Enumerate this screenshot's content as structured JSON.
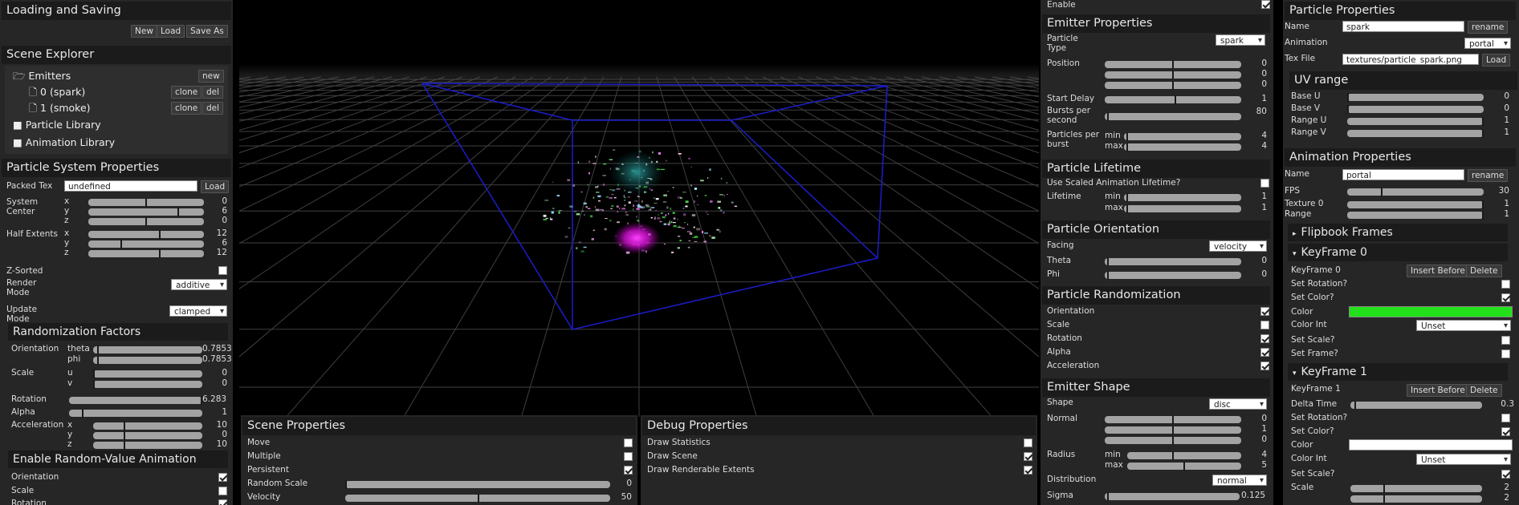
{
  "left": {
    "loading": {
      "title": "Loading and Saving",
      "new": "New",
      "load": "Load",
      "save_as": "Save As"
    },
    "scene_explorer": {
      "title": "Scene Explorer",
      "emitters": "Emitters",
      "new": "new",
      "items": [
        "0 (spark)",
        "1 (smoke)"
      ],
      "clone": "clone",
      "del": "del",
      "particle_library": "Particle Library",
      "animation_library": "Animation Library"
    },
    "psp": {
      "title": "Particle System Properties",
      "packed_tex_label": "Packed Tex",
      "packed_tex_value": "undefined",
      "load": "Load",
      "system_center": "System\nCenter",
      "half_extents": "Half Extents",
      "x": "x",
      "y": "y",
      "z": "z",
      "center_vals": [
        "0",
        "6",
        "0"
      ],
      "center_fill": [
        0.5,
        0.78,
        0.5
      ],
      "extent_vals": [
        "12",
        "6",
        "12"
      ],
      "extent_fill": [
        0.62,
        0.28,
        0.62
      ],
      "zsorted": "Z-Sorted",
      "render_mode": "Render\nMode",
      "render_mode_value": "additive",
      "update_mode": "Update\nMode",
      "update_mode_value": "clamped"
    },
    "rand": {
      "title": "Randomization Factors",
      "orientation": "Orientation",
      "theta": "theta",
      "phi": "phi",
      "theta_val": "0.7853",
      "phi_val": "0.7853",
      "scale": "Scale",
      "u": "u",
      "v": "v",
      "u_val": "0",
      "v_val": "0",
      "rotation": "Rotation",
      "rotation_val": "6.283",
      "alpha": "Alpha",
      "alpha_val": "1",
      "acceleration": "Acceleration",
      "acc_vals": [
        "10",
        "0",
        "10"
      ]
    },
    "anim": {
      "title": "Enable Random-Value Animation",
      "orientation": "Orientation",
      "scale": "Scale",
      "rotation": "Rotation"
    }
  },
  "bottom": {
    "scene": {
      "title": "Scene Properties",
      "move": "Move",
      "multiple": "Multiple",
      "persistent": "Persistent",
      "random_scale": "Random Scale",
      "random_scale_val": "0",
      "velocity": "Velocity",
      "velocity_val": "50"
    },
    "debug": {
      "title": "Debug Properties",
      "stats": "Draw Statistics",
      "scene": "Draw Scene",
      "extents": "Draw Renderable Extents"
    }
  },
  "mid": {
    "enable": "Enable",
    "emitter": {
      "title": "Emitter Properties",
      "particle_type": "Particle\nType",
      "particle_type_value": "spark",
      "position": "Position",
      "pos_vals": [
        "0",
        "0",
        "0"
      ],
      "start_delay": "Start Delay",
      "start_delay_val": "1",
      "bursts": "Bursts per\nsecond",
      "bursts_val": "80",
      "particles": "Particles per\nburst",
      "min": "min",
      "max": "max",
      "min_val": "4",
      "max_val": "4"
    },
    "lifetime": {
      "title": "Particle Lifetime",
      "use_scaled": "Use Scaled Animation Lifetime?",
      "lifetime": "Lifetime",
      "min": "min",
      "max": "max",
      "min_val": "1",
      "max_val": "1"
    },
    "orientation": {
      "title": "Particle Orientation",
      "facing": "Facing",
      "facing_value": "velocity",
      "theta": "Theta",
      "phi": "Phi",
      "theta_val": "0",
      "phi_val": "0"
    },
    "randomization": {
      "title": "Particle Randomization",
      "items": [
        "Orientation",
        "Scale",
        "Rotation",
        "Alpha",
        "Acceleration"
      ]
    },
    "shape": {
      "title": "Emitter Shape",
      "shape": "Shape",
      "shape_value": "disc",
      "normal": "Normal",
      "normal_vals": [
        "0",
        "1",
        "0"
      ],
      "radius": "Radius",
      "min": "min",
      "max": "max",
      "rmin": "4",
      "rmax": "5",
      "distribution": "Distribution",
      "distribution_value": "normal",
      "sigma": "Sigma",
      "sigma_val": "0.125"
    }
  },
  "right": {
    "pp": {
      "title": "Particle Properties",
      "name": "Name",
      "name_value": "spark",
      "rename": "rename",
      "animation": "Animation",
      "animation_value": "portal",
      "tex_file": "Tex File",
      "tex_file_value": "textures/particle_spark.png",
      "load": "Load"
    },
    "uv": {
      "title": "UV range",
      "base_u": "Base U",
      "base_v": "Base V",
      "range_u": "Range U",
      "range_v": "Range V",
      "vals": [
        "0",
        "0",
        "1",
        "1"
      ]
    },
    "ap": {
      "title": "Animation Properties",
      "name": "Name",
      "name_value": "portal",
      "rename": "rename",
      "fps": "FPS",
      "fps_val": "30",
      "texture0": "Texture 0",
      "texture0_val": "1",
      "range": "Range",
      "range_val": "1"
    },
    "flipbook": "Flipbook Frames",
    "kf0": {
      "title": "KeyFrame 0",
      "label": "KeyFrame 0",
      "insert": "Insert Before",
      "delete": "Delete",
      "set_rotation": "Set Rotation?",
      "set_color": "Set Color?",
      "color": "Color",
      "color_value": "#22e01a",
      "color_int": "Color Int",
      "color_int_value": "Unset",
      "set_scale": "Set Scale?",
      "set_frame": "Set Frame?"
    },
    "kf1": {
      "title": "KeyFrame 1",
      "label": "KeyFrame 1",
      "insert": "Insert Before",
      "delete": "Delete",
      "delta_time": "Delta Time",
      "delta_time_val": "0.3",
      "set_rotation": "Set Rotation?",
      "set_color": "Set Color?",
      "color": "Color",
      "color_value": "#ffffff",
      "color_int": "Color Int",
      "color_int_value": "Unset",
      "set_scale": "Set Scale?",
      "scale": "Scale",
      "scale_vals": [
        "2",
        "2"
      ]
    }
  }
}
